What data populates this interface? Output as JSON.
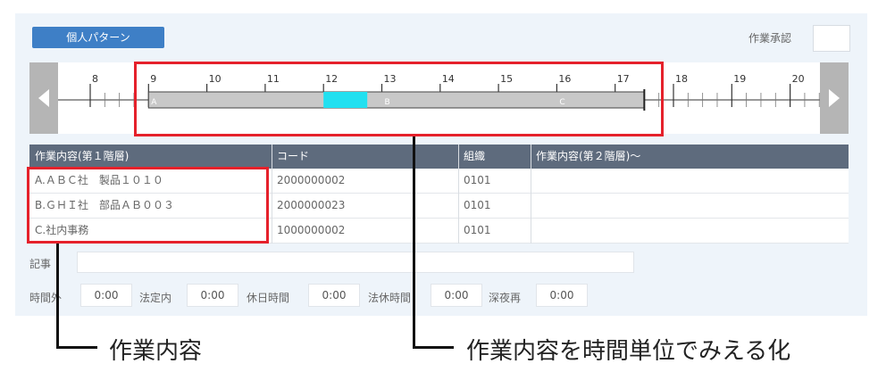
{
  "header": {
    "pattern_button": "個人パターン",
    "approval_label": "作業承認"
  },
  "timeline": {
    "hours": [
      "8",
      "9",
      "10",
      "11",
      "12",
      "13",
      "14",
      "15",
      "16",
      "17",
      "18",
      "19",
      "20"
    ],
    "segment_labels": [
      "A",
      "B",
      "C"
    ],
    "highlight_color": "#22e0f0",
    "bar_color": "#c8c8c8"
  },
  "table": {
    "headers": [
      "作業内容(第１階層)",
      "コード",
      "組織",
      "作業内容(第２階層)～"
    ],
    "rows": [
      {
        "task": "A.ＡＢＣ社　製品１０１０",
        "code": "2000000002",
        "org": "0101",
        "sub": ""
      },
      {
        "task": "B.ＧＨＩ社　部品ＡＢ００３",
        "code": "2000000023",
        "org": "0101",
        "sub": ""
      },
      {
        "task": "C.社内事務",
        "code": "1000000002",
        "org": "0101",
        "sub": ""
      }
    ]
  },
  "memo": {
    "label": "記事",
    "value": ""
  },
  "hours_fields": [
    {
      "label": "時間外",
      "value": "0:00"
    },
    {
      "label": "法定内",
      "value": "0:00"
    },
    {
      "label": "休日時間",
      "value": "0:00"
    },
    {
      "label": "法休時間",
      "value": "0:00"
    },
    {
      "label": "深夜再",
      "value": "0:00"
    }
  ],
  "callouts": {
    "left": "作業内容",
    "right": "作業内容を時間単位でみえる化"
  },
  "colors": {
    "accent": "#3e7fc6",
    "highlight": "#e5212b",
    "table_header": "#5e6b7d"
  }
}
